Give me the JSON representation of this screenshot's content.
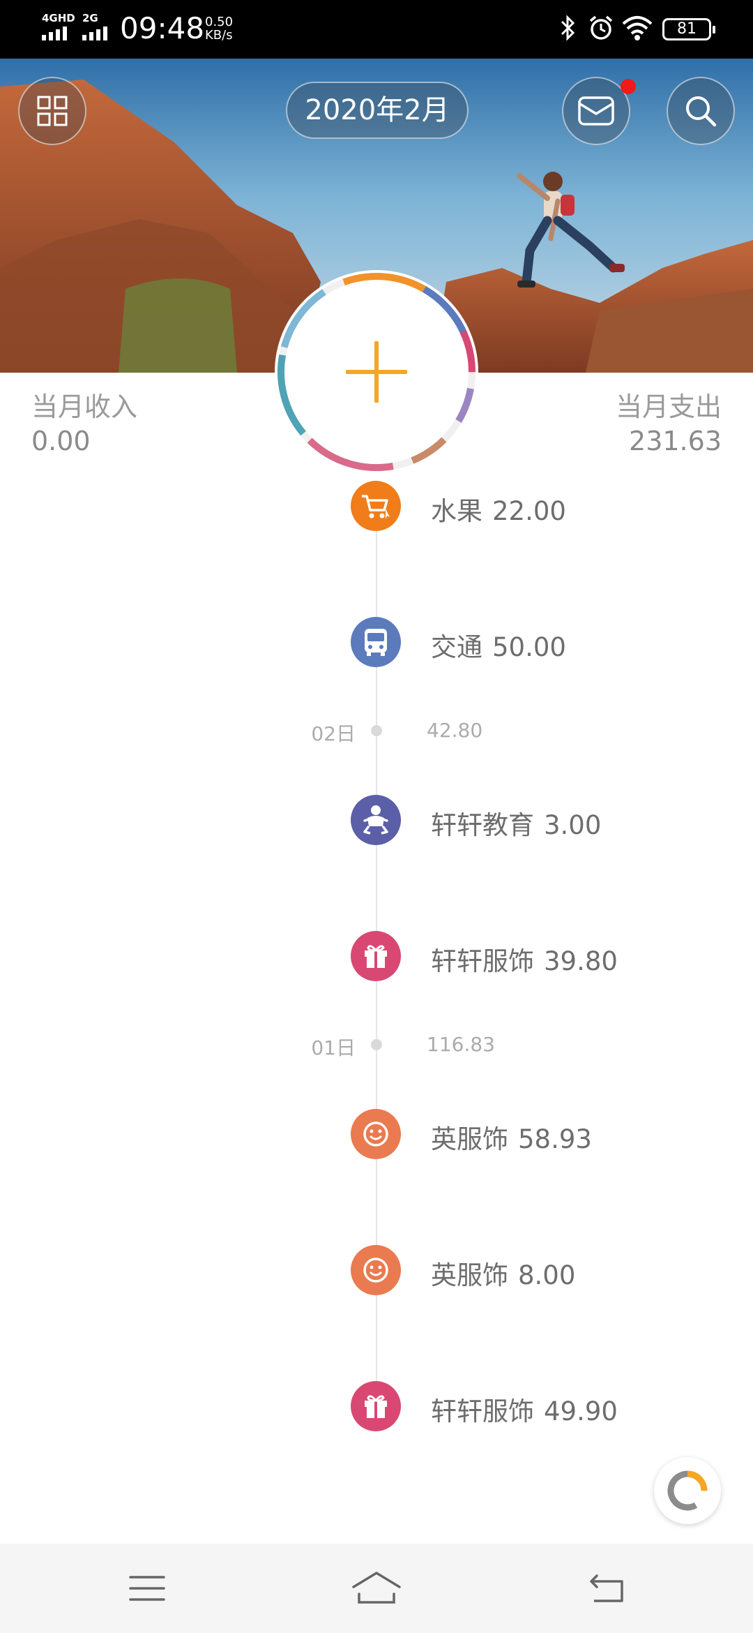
{
  "status_bar": {
    "network1": "4GHD",
    "network2": "2G",
    "time": "09:48",
    "speed_value": "0.50",
    "speed_unit": "KB/s",
    "battery": "81",
    "icons": [
      "bluetooth-icon",
      "alarm-icon",
      "wifi-icon",
      "battery-icon"
    ]
  },
  "header": {
    "month": "2020年2月",
    "has_unread_message": true,
    "icons": [
      "grid-menu-icon",
      "mail-icon",
      "search-icon"
    ]
  },
  "summary": {
    "income_label": "当月收入",
    "income_value": "0.00",
    "expense_label": "当月支出",
    "expense_value": "231.63"
  },
  "add_button": {
    "icon": "plus-icon",
    "accent": "#f5a623"
  },
  "timeline": {
    "entries": [
      {
        "category": "水果",
        "amount": "22.00",
        "icon": "cart-icon",
        "color": "#f07d1a"
      },
      {
        "category": "交通",
        "amount": "50.00",
        "icon": "bus-icon",
        "color": "#5b7bbd"
      },
      {
        "category": "轩轩教育",
        "amount": "3.00",
        "icon": "baby-icon",
        "color": "#5a5fa8"
      },
      {
        "category": "轩轩服饰",
        "amount": "39.80",
        "icon": "gift-icon",
        "color": "#d94873"
      },
      {
        "category": "英服饰",
        "amount": "58.93",
        "icon": "smiley-icon",
        "color": "#ea7a50"
      },
      {
        "category": "英服饰",
        "amount": "8.00",
        "icon": "smiley-icon",
        "color": "#ea7a50"
      },
      {
        "category": "轩轩服饰",
        "amount": "49.90",
        "icon": "gift-icon",
        "color": "#d94873"
      }
    ],
    "days": [
      {
        "day": "02日",
        "total": "42.80"
      },
      {
        "day": "01日",
        "total": "116.83"
      }
    ]
  },
  "nav": {
    "icons": [
      "menu-icon",
      "home-icon",
      "back-icon"
    ]
  }
}
